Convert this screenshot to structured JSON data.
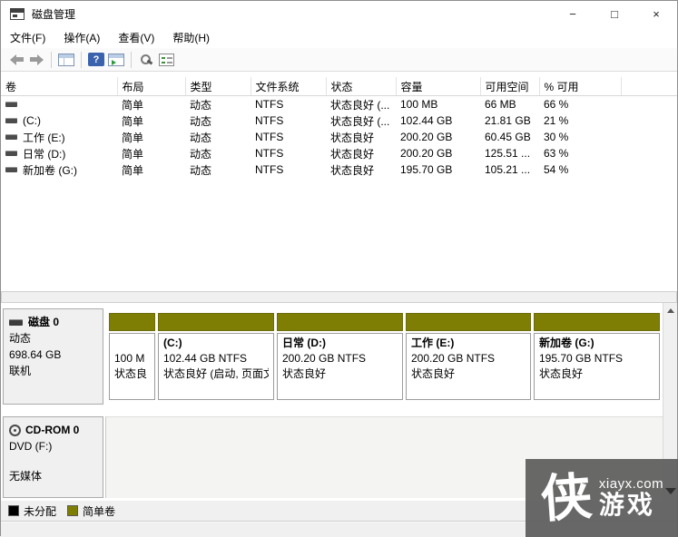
{
  "window": {
    "title": "磁盘管理",
    "controls": {
      "minimize": "−",
      "maximize": "□",
      "close": "×"
    }
  },
  "menu": {
    "items": [
      "文件(F)",
      "操作(A)",
      "查看(V)",
      "帮助(H)"
    ]
  },
  "toolbar": {
    "icon_names": [
      "back-icon",
      "forward-icon",
      "console-tree-icon",
      "help-icon",
      "action-pane-icon",
      "magnifier-icon",
      "checklist-icon"
    ],
    "help_glyph": "?"
  },
  "volume_table": {
    "columns": [
      "卷",
      "布局",
      "类型",
      "文件系统",
      "状态",
      "容量",
      "可用空间",
      "% 可用"
    ],
    "rows": [
      {
        "name": "",
        "layout": "简单",
        "type": "动态",
        "fs": "NTFS",
        "status": "状态良好 (...",
        "capacity": "100 MB",
        "free": "66 MB",
        "pct": "66 %"
      },
      {
        "name": "(C:)",
        "layout": "简单",
        "type": "动态",
        "fs": "NTFS",
        "status": "状态良好 (...",
        "capacity": "102.44 GB",
        "free": "21.81 GB",
        "pct": "21 %"
      },
      {
        "name": "工作 (E:)",
        "layout": "简单",
        "type": "动态",
        "fs": "NTFS",
        "status": "状态良好",
        "capacity": "200.20 GB",
        "free": "60.45 GB",
        "pct": "30 %"
      },
      {
        "name": "日常 (D:)",
        "layout": "简单",
        "type": "动态",
        "fs": "NTFS",
        "status": "状态良好",
        "capacity": "200.20 GB",
        "free": "125.51 ...",
        "pct": "63 %"
      },
      {
        "name": "新加卷 (G:)",
        "layout": "简单",
        "type": "动态",
        "fs": "NTFS",
        "status": "状态良好",
        "capacity": "195.70 GB",
        "free": "105.21 ...",
        "pct": "54 %"
      }
    ]
  },
  "disk0": {
    "title": "磁盘 0",
    "type": "动态",
    "size": "698.64 GB",
    "status": "联机",
    "partitions": [
      {
        "name": "",
        "size": "100 M",
        "status": "状态良"
      },
      {
        "name": "(C:)",
        "size": "102.44 GB NTFS",
        "status": "状态良好 (启动, 页面文"
      },
      {
        "name": "日常  (D:)",
        "size": "200.20 GB NTFS",
        "status": "状态良好"
      },
      {
        "name": "工作  (E:)",
        "size": "200.20 GB NTFS",
        "status": "状态良好"
      },
      {
        "name": "新加卷  (G:)",
        "size": "195.70 GB NTFS",
        "status": "状态良好"
      }
    ]
  },
  "cdrom": {
    "title": "CD-ROM 0",
    "drive": "DVD (F:)",
    "media": "无媒体"
  },
  "legend": {
    "items": [
      {
        "label": "未分配",
        "color": "#000000"
      },
      {
        "label": "简单卷",
        "color": "#7e7e04"
      }
    ]
  },
  "watermark": {
    "char": "侠",
    "site": "xiayx.com",
    "word": "游戏"
  },
  "colors": {
    "simple_volume": "#7e7e04",
    "unallocated": "#000000"
  }
}
